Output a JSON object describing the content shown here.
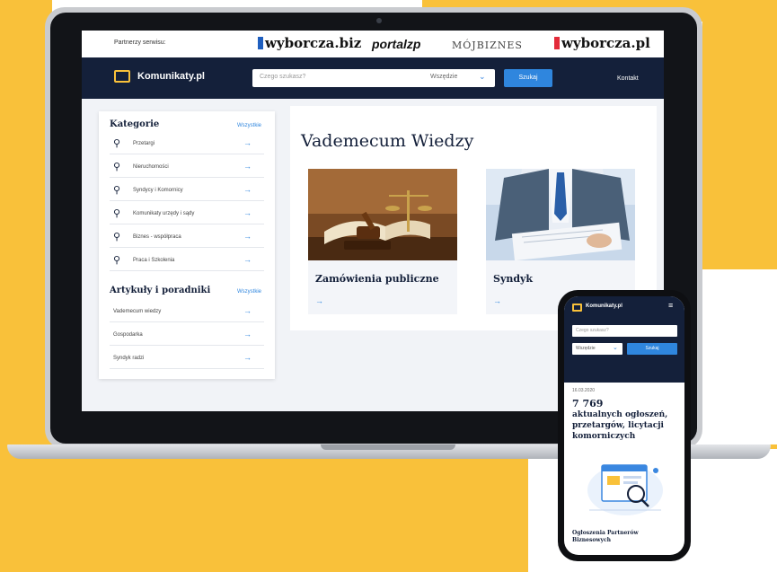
{
  "partners": {
    "label": "Partnerzy serwisu:",
    "logos": [
      "wyborcza.biz",
      "portalzp",
      "MÓJBIZNES",
      "wyborcza.pl"
    ]
  },
  "header": {
    "brand": "Komunikaty.pl",
    "search_placeholder": "Czego szukasz?",
    "scope": "Wszędzie",
    "search_button": "Szukaj",
    "contact": "Kontakt"
  },
  "sidebar": {
    "categories_title": "Kategorie",
    "categories_all": "Wszystkie",
    "categories": [
      {
        "label": "Przetargi"
      },
      {
        "label": "Nieruchomości"
      },
      {
        "label": "Syndycy i Komornicy"
      },
      {
        "label": "Komunikaty urzędy i sądy"
      },
      {
        "label": "Biznes - współpraca"
      },
      {
        "label": "Praca i Szkolenia"
      }
    ],
    "articles_title": "Artykuły i poradniki",
    "articles_all": "Wszystkie",
    "articles": [
      {
        "label": "Vademecum wiedzy"
      },
      {
        "label": "Gospodarka"
      },
      {
        "label": "Syndyk radzi"
      }
    ],
    "arrow": "→"
  },
  "main": {
    "title": "Vademecum Wiedzy",
    "cards": [
      {
        "title": "Zamówienia publiczne"
      },
      {
        "title": "Syndyk"
      }
    ],
    "card_arrow": "→"
  },
  "mobile": {
    "brand": "Komunikaty.pl",
    "search_placeholder": "Czego szukasz?",
    "scope": "Wszędzie",
    "search_button": "Szukaj",
    "date": "16.03.2020",
    "count": "7 769",
    "description": "aktualnych ogłoszeń, przetargów, licytacji komorniczych",
    "footer_title": "Ogłoszenia Partnerów Biznesowych"
  },
  "colors": {
    "accent_yellow": "#f9c13a",
    "navy": "#14203a",
    "link_blue": "#2f86de"
  }
}
